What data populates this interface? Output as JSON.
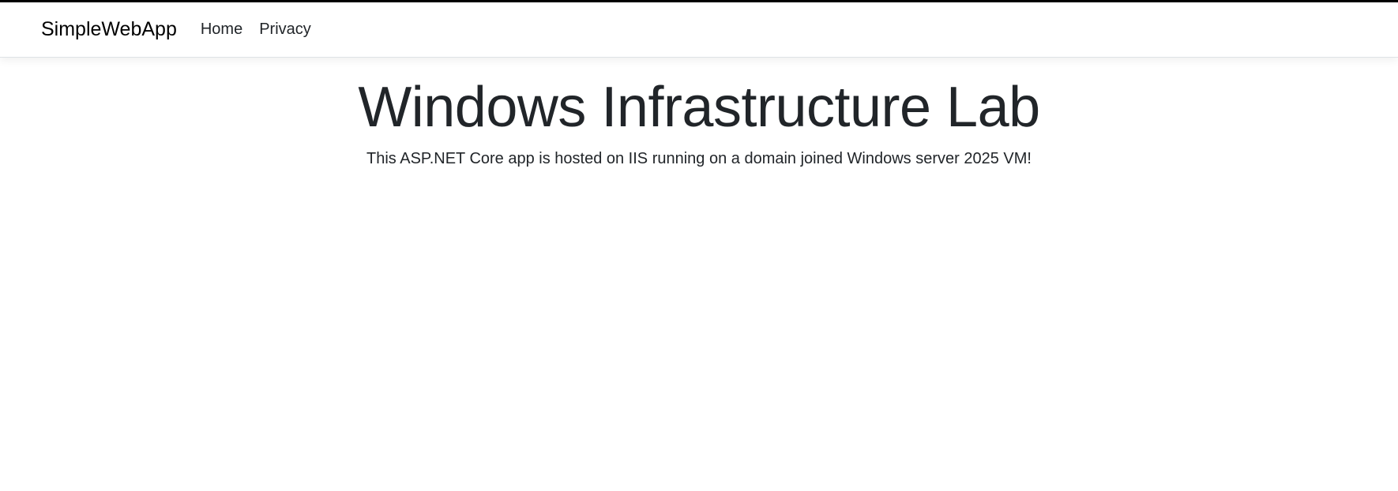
{
  "navbar": {
    "brand": "SimpleWebApp",
    "links": [
      {
        "label": "Home"
      },
      {
        "label": "Privacy"
      }
    ]
  },
  "main": {
    "title": "Windows Infrastructure Lab",
    "description": "This ASP.NET Core app is hosted on IIS running on a domain joined Windows server 2025 VM!"
  },
  "colors": {
    "text": "#212529",
    "brand": "#000000",
    "border": "#dee2e6",
    "background": "#ffffff"
  }
}
